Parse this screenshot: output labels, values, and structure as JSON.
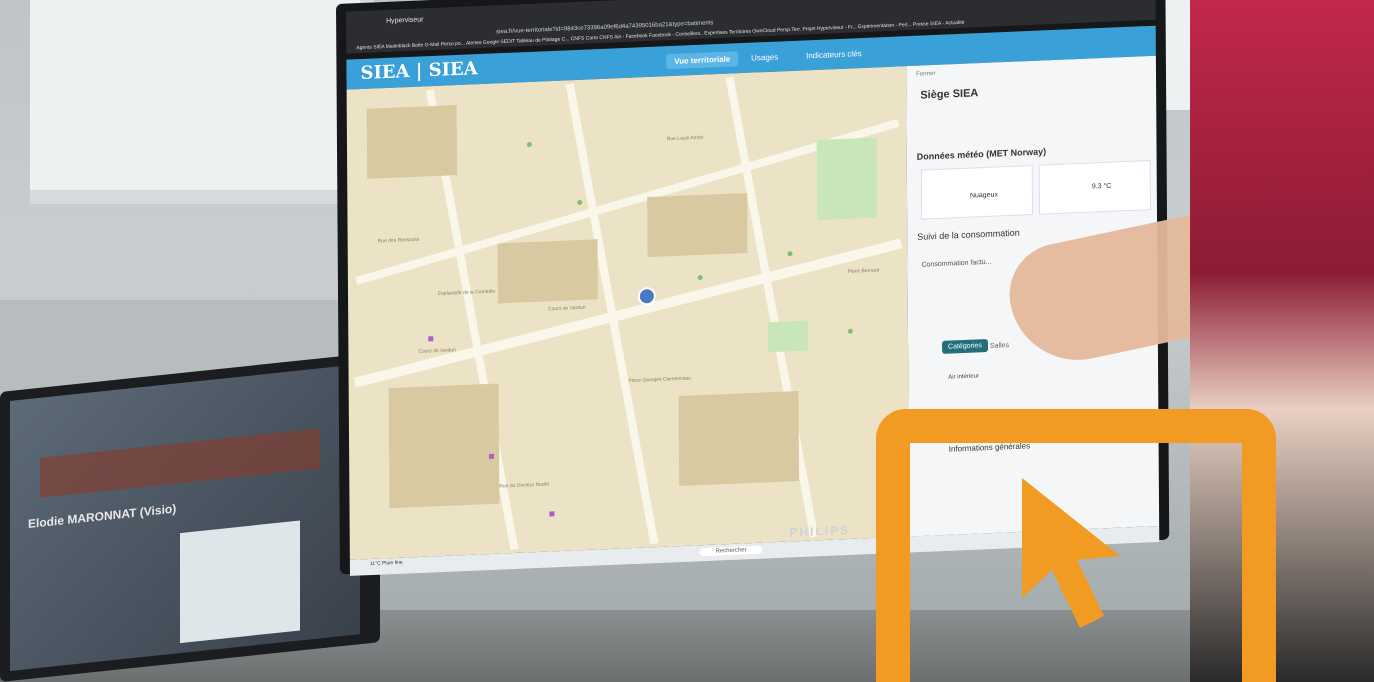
{
  "browser": {
    "tab_title": "Hyperviseur",
    "url": "siea.fr/vue-territoriale?id=9843ce73396a09ef6d4a74395016ba21&type=batiments",
    "bookmarks": "Agents SIEA  Mailinblack  Boite G-Mail Perso po...  Alertes Google  SEDIT  Tableau de Pilotage C...  CNFS Carto  CNFS Ain - Facebook  Facebook - Conseillers..  Expertises Territoires  OwnCloud Persp.Terr.  Projet Hyperviseur - Fr...  Expérimentation - Perl...  Presse SIEA - Actualité"
  },
  "app": {
    "logo": "SIEA | SIEA",
    "nav": {
      "vue": "Vue territoriale",
      "usages": "Usages",
      "indicateurs": "Indicateurs clés"
    }
  },
  "map": {
    "labels": [
      "Rue Louis Amiot",
      "Rue des Remparts",
      "Cours de Verdun",
      "Cours de Verdun",
      "Esplanade de la Comédie",
      "Place Bernard",
      "Place Georges Clemenceau",
      "Rue du Docteur Nodet"
    ]
  },
  "panel": {
    "close": "Fermer",
    "site_name": "Siège SIEA",
    "meteo_title": "Données météo (MET Norway)",
    "condition": "Nuageux",
    "temperature": "9.3 °C",
    "suivi": "Suivi de la consommation",
    "conso": "Consommation factu...",
    "tab_categories": "Catégories",
    "tab_salles": "Salles",
    "air": "Air intérieur",
    "info": "Informations générales"
  },
  "taskbar": {
    "weather": "11°C Pluie fine",
    "search": "Rechercher"
  },
  "monitor_brand": "PHILIPS",
  "laptop": {
    "title": "Elodie MARONNAT (Visio)"
  },
  "overlay": {
    "color": "#f19b22",
    "icon": "computer-cursor-icon"
  }
}
